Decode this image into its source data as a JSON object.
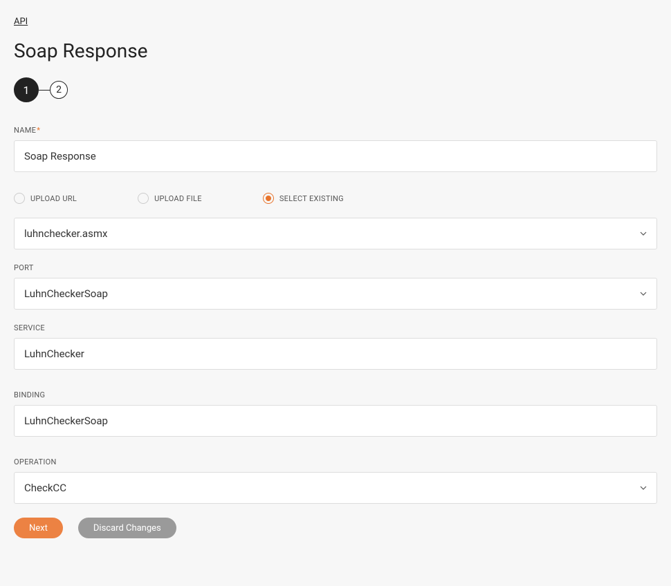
{
  "breadcrumb": {
    "link": "API"
  },
  "page_title": "Soap Response",
  "stepper": {
    "step1": "1",
    "step2": "2"
  },
  "fields": {
    "name": {
      "label": "NAME",
      "value": "Soap Response"
    },
    "source_options": {
      "upload_url": "UPLOAD URL",
      "upload_file": "UPLOAD FILE",
      "select_existing": "SELECT EXISTING"
    },
    "existing_file": {
      "value": "luhnchecker.asmx"
    },
    "port": {
      "label": "PORT",
      "value": "LuhnCheckerSoap"
    },
    "service": {
      "label": "SERVICE",
      "value": "LuhnChecker"
    },
    "binding": {
      "label": "BINDING",
      "value": "LuhnCheckerSoap"
    },
    "operation": {
      "label": "OPERATION",
      "value": "CheckCC"
    }
  },
  "buttons": {
    "next": "Next",
    "discard": "Discard Changes"
  }
}
